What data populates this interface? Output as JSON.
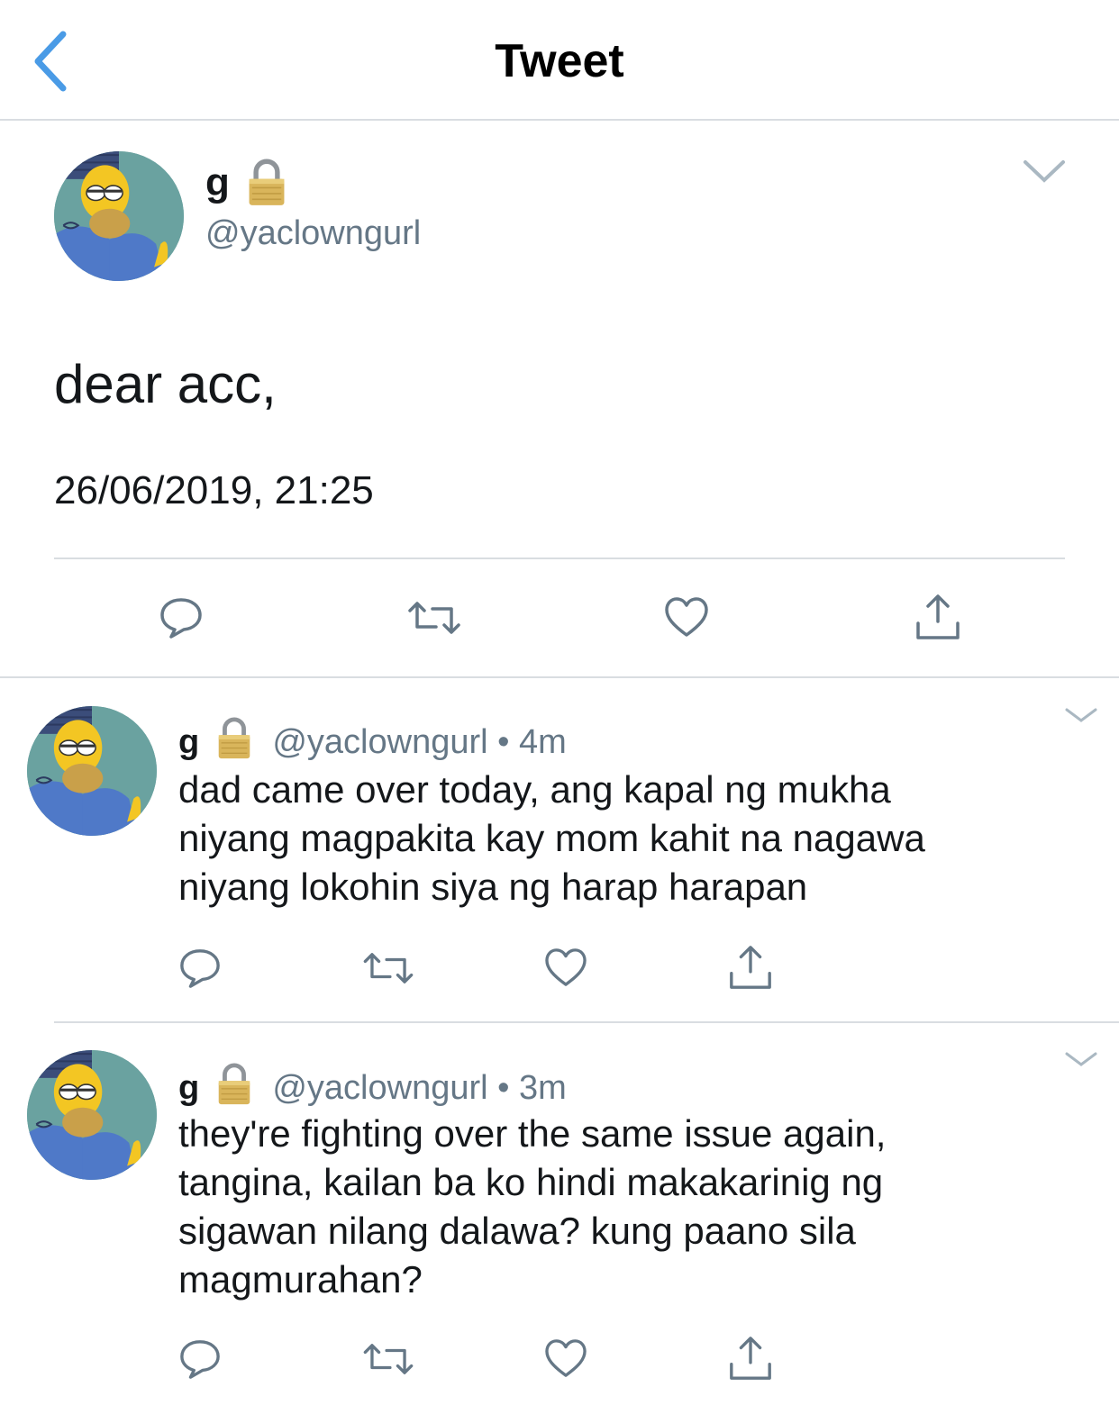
{
  "header": {
    "title": "Tweet",
    "back_icon": "chevron-left-icon",
    "accent": "#4a9be6"
  },
  "main_tweet": {
    "name": "g",
    "handle": "@yaclowngurl",
    "text": "dear acc,",
    "timestamp": "26/06/2019, 21:25",
    "actions": [
      "reply-icon",
      "retweet-icon",
      "like-icon",
      "share-icon"
    ]
  },
  "replies": [
    {
      "name": "g",
      "handle": "@yaclowngurl",
      "dot": "•",
      "time": "4m",
      "lines": [
        "dad came over today, ang kapal ng mukha",
        "niyang magpakita kay mom kahit na nagawa",
        "niyang lokohin siya ng harap harapan"
      ]
    },
    {
      "name": "g",
      "handle": "@yaclowngurl",
      "dot": "•",
      "time": "3m",
      "lines": [
        "they're fighting over the same issue again,",
        "tangina, kailan ba ko hindi makakarinig ng",
        "sigawan nilang dalawa? kung paano sila",
        "magmurahan?"
      ]
    }
  ],
  "colors": {
    "text": "#14171a",
    "secondary": "#657786",
    "divider": "#d9dde1",
    "icon": "#657786"
  }
}
